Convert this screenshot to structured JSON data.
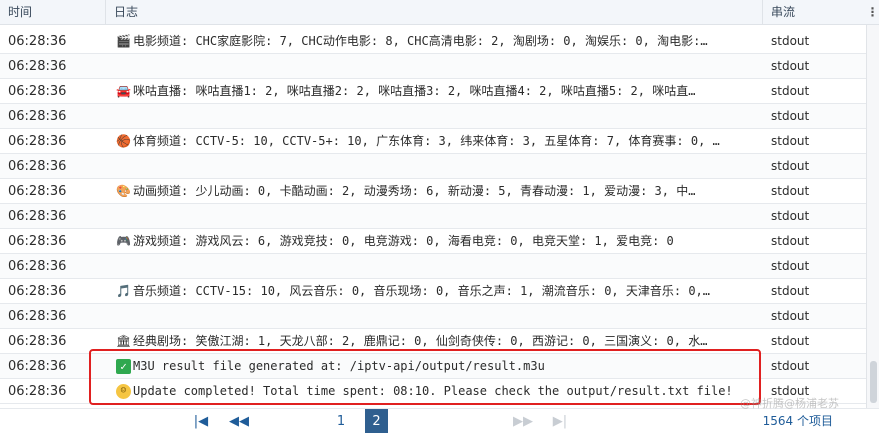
{
  "header": {
    "time": "时间",
    "log": "日志",
    "stream": "串流",
    "menu": "⋮"
  },
  "rows": [
    {
      "time": "06:28:36",
      "icon": "🎬",
      "icon_name": "film-clapper-icon",
      "log": "电影频道: CHC家庭影院: 7, CHC动作电影: 8, CHC高清电影: 2, 淘剧场: 0, 淘娱乐: 0, 淘电影:…",
      "stream": "stdout"
    },
    {
      "time": "06:28:36",
      "icon": "",
      "icon_name": "",
      "log": "",
      "stream": "stdout"
    },
    {
      "time": "06:28:36",
      "icon": "🚘",
      "icon_name": "car-icon",
      "log": "咪咕直播: 咪咕直播1: 2, 咪咕直播2: 2, 咪咕直播3: 2, 咪咕直播4: 2, 咪咕直播5: 2, 咪咕直…",
      "stream": "stdout"
    },
    {
      "time": "06:28:36",
      "icon": "",
      "icon_name": "",
      "log": "",
      "stream": "stdout"
    },
    {
      "time": "06:28:36",
      "icon": "🏀",
      "icon_name": "basketball-icon",
      "log": "体育频道: CCTV-5: 10, CCTV-5+: 10, 广东体育: 3, 纬来体育: 3, 五星体育: 7, 体育赛事: 0, …",
      "stream": "stdout"
    },
    {
      "time": "06:28:36",
      "icon": "",
      "icon_name": "",
      "log": "",
      "stream": "stdout"
    },
    {
      "time": "06:28:36",
      "icon": "🎨",
      "icon_name": "animation-icon",
      "log": "动画频道: 少儿动画: 0, 卡酷动画: 2, 动漫秀场: 6, 新动漫: 5, 青春动漫: 1, 爱动漫: 3, 中…",
      "stream": "stdout"
    },
    {
      "time": "06:28:36",
      "icon": "",
      "icon_name": "",
      "log": "",
      "stream": "stdout"
    },
    {
      "time": "06:28:36",
      "icon": "🎮",
      "icon_name": "gamepad-icon",
      "log": "游戏频道: 游戏风云: 6, 游戏竞技: 0, 电竞游戏: 0, 海看电竞: 0, 电竞天堂: 1, 爱电竞: 0",
      "stream": "stdout"
    },
    {
      "time": "06:28:36",
      "icon": "",
      "icon_name": "",
      "log": "",
      "stream": "stdout"
    },
    {
      "time": "06:28:36",
      "icon": "🎵",
      "icon_name": "music-note-icon",
      "log": "音乐频道: CCTV-15: 10, 风云音乐: 0, 音乐现场: 0, 音乐之声: 1, 潮流音乐: 0, 天津音乐: 0,…",
      "stream": "stdout"
    },
    {
      "time": "06:28:36",
      "icon": "",
      "icon_name": "",
      "log": "",
      "stream": "stdout"
    },
    {
      "time": "06:28:36",
      "icon": "🏛",
      "icon_name": "classical-building-icon",
      "log": "经典剧场: 笑傲江湖: 1, 天龙八部: 2, 鹿鼎记: 0, 仙剑奇侠传: 0, 西游记: 0, 三国演义: 0, 水…",
      "stream": "stdout"
    },
    {
      "time": "06:28:36",
      "icon": "✓",
      "icon_name": "check-mark-icon",
      "log": "M3U result file generated at: /iptv-api/output/result.m3u",
      "stream": "stdout"
    },
    {
      "time": "06:28:36",
      "icon": "☺",
      "icon_name": "smiley-face-icon",
      "log": "Update completed! Total time spent: 08:10. Please check the output/result.txt file!",
      "stream": "stdout"
    }
  ],
  "pagination": {
    "first": "|◀",
    "prev": "◀◀",
    "page1": "1",
    "page2": "2",
    "next": "▶▶",
    "last": "▶|",
    "count": "1564 个项目"
  },
  "watermark": "@神折腾@杨浦老苏",
  "colors": {
    "highlight_border": "#e02020",
    "active_page_bg": "#2f5f8f",
    "link": "#1f5c99"
  }
}
